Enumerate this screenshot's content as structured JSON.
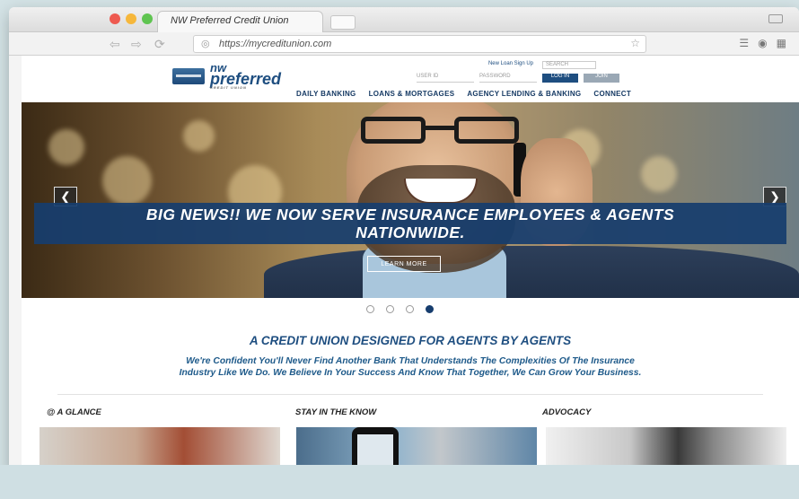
{
  "browser": {
    "tab_title": "NW Preferred Credit Union",
    "url": "https://mycreditunion.com"
  },
  "site": {
    "logo": {
      "line1": "nw",
      "line2": "preferred",
      "sub": "CREDIT UNION"
    },
    "utility": {
      "new_loan": "New Loan Sign Up",
      "search_placeholder": "SEARCH",
      "userid_placeholder": "USER ID",
      "password_placeholder": "PASSWORD",
      "login_label": "LOG IN",
      "join_label": "JOIN"
    },
    "nav": [
      "DAILY BANKING",
      "LOANS & MORTGAGES",
      "AGENCY LENDING & BANKING",
      "CONNECT"
    ],
    "hero": {
      "headline_line1": "BIG NEWS!! WE NOW SERVE INSURANCE EMPLOYEES & AGENTS",
      "headline_line2": "NATIONWIDE.",
      "cta": "LEARN MORE",
      "slide_count": 4,
      "active_slide": 4
    },
    "tagline": "A CREDIT UNION DESIGNED FOR AGENTS BY AGENTS",
    "subtagline_line1": "We're Confident You'll Never Find Another Bank That Understands The Complexities Of The Insurance",
    "subtagline_line2": "Industry Like We Do. We Believe In Your Success And Know That Together, We Can Grow Your Business.",
    "columns": [
      "@ A GLANCE",
      "STAY IN THE KNOW",
      "ADVOCACY"
    ]
  }
}
